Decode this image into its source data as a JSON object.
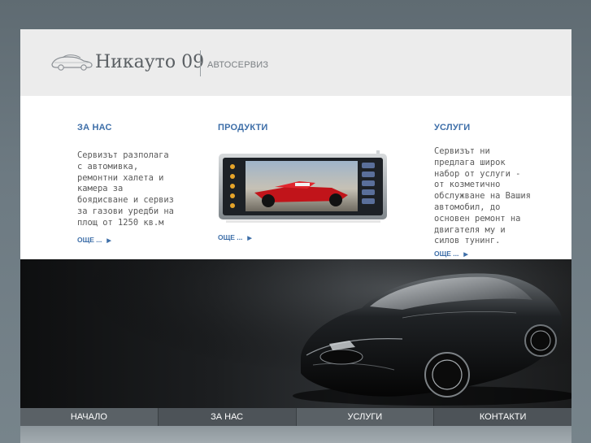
{
  "header": {
    "brand_name": "Никауто 09",
    "brand_sub": "АВТОСЕРВИЗ",
    "logo_icon": "car-logo-icon"
  },
  "columns": [
    {
      "title": "ЗА НАС",
      "text": "Сервизът разполага с автомивка, ремонтни халета и камера за боядисване и сервиз за газови уредби на площ от 1250 кв.м",
      "more": "ОЩЕ ..."
    },
    {
      "title": "ПРОДУКТИ",
      "image": "car-multimedia-player-image",
      "more": "ОЩЕ ..."
    },
    {
      "title": "УСЛУГИ",
      "text": "Сервизът ни предлага широк набор от услуги - от козметично обслужване на Вашия автомобил, до основен ремонт на двигателя му и силов тунинг.",
      "more": "ОЩЕ ..."
    }
  ],
  "hero": {
    "image": "black-sports-car-image"
  },
  "nav": {
    "items": [
      "НАЧАЛО",
      "ЗА НАС",
      "УСЛУГИ",
      "КОНТАКТИ"
    ]
  },
  "colors": {
    "accent": "#3d6ea8",
    "header_bg": "#ececec",
    "nav_bg": "#4d5358",
    "page_bg": "#6d7a82"
  }
}
